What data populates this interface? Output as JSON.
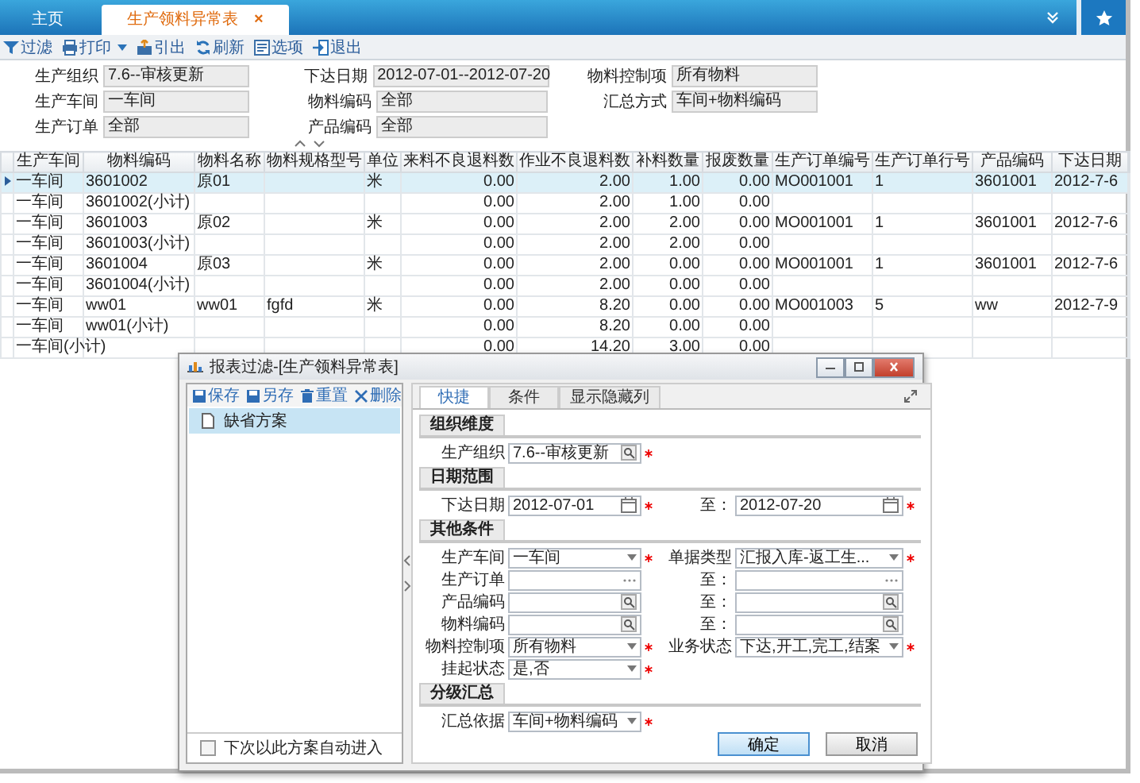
{
  "tabs": [
    {
      "label": "主页",
      "selected": false
    },
    {
      "label": "生产领料异常表",
      "selected": true,
      "close": "×"
    }
  ],
  "toolbar": [
    {
      "label": "过滤",
      "dropdown": false
    },
    {
      "label": "打印",
      "dropdown": true
    },
    {
      "label": "引出",
      "dropdown": false
    },
    {
      "label": "刷新",
      "dropdown": false
    },
    {
      "label": "选项",
      "dropdown": false
    },
    {
      "label": "退出",
      "dropdown": false
    }
  ],
  "summary": [
    {
      "label": "生产组织",
      "value": "7.6--审核更新"
    },
    {
      "label": "下达日期",
      "value": "2012-07-01--2012-07-20"
    },
    {
      "label": "物料控制项",
      "value": "所有物料"
    },
    {
      "label": "生产车间",
      "value": "一车间"
    },
    {
      "label": "物料编码",
      "value": "全部"
    },
    {
      "label": "汇总方式",
      "value": "车间+物料编码"
    },
    {
      "label": "生产订单",
      "value": "全部"
    },
    {
      "label": "产品编码",
      "value": "全部"
    }
  ],
  "grid": {
    "columns": [
      {
        "label": "生产车间",
        "kind": "text"
      },
      {
        "label": "物料编码",
        "kind": "text"
      },
      {
        "label": "物料名称",
        "kind": "text"
      },
      {
        "label": "物料规格型号",
        "kind": "text"
      },
      {
        "label": "单位",
        "kind": "text"
      },
      {
        "label": "来料不良退料数",
        "kind": "number"
      },
      {
        "label": "作业不良退料数",
        "kind": "number"
      },
      {
        "label": "补料数量",
        "kind": "number"
      },
      {
        "label": "报废数量",
        "kind": "number"
      },
      {
        "label": "生产订单编号",
        "kind": "text"
      },
      {
        "label": "生产订单行号",
        "kind": "text"
      },
      {
        "label": "产品编码",
        "kind": "text"
      },
      {
        "label": "下达日期",
        "kind": "text"
      }
    ],
    "rows": [
      {
        "selected": true,
        "cells": [
          "一车间",
          "3601002",
          "原01",
          null,
          "米",
          "0.00",
          "2.00",
          "1.00",
          "0.00",
          "MO001001",
          "1",
          "3601001",
          "2012-7-6"
        ]
      },
      {
        "selected": false,
        "cells": [
          "一车间",
          "3601002(小计)",
          null,
          null,
          null,
          "0.00",
          "2.00",
          "1.00",
          "0.00",
          null,
          null,
          null,
          null
        ]
      },
      {
        "selected": false,
        "cells": [
          "一车间",
          "3601003",
          "原02",
          null,
          "米",
          "0.00",
          "2.00",
          "2.00",
          "0.00",
          "MO001001",
          "1",
          "3601001",
          "2012-7-6"
        ]
      },
      {
        "selected": false,
        "cells": [
          "一车间",
          "3601003(小计)",
          null,
          null,
          null,
          "0.00",
          "2.00",
          "2.00",
          "0.00",
          null,
          null,
          null,
          null
        ]
      },
      {
        "selected": false,
        "cells": [
          "一车间",
          "3601004",
          "原03",
          null,
          "米",
          "0.00",
          "2.00",
          "0.00",
          "0.00",
          "MO001001",
          "1",
          "3601001",
          "2012-7-6"
        ]
      },
      {
        "selected": false,
        "cells": [
          "一车间",
          "3601004(小计)",
          null,
          null,
          null,
          "0.00",
          "2.00",
          "0.00",
          "0.00",
          null,
          null,
          null,
          null
        ]
      },
      {
        "selected": false,
        "cells": [
          "一车间",
          "ww01",
          "ww01",
          "fgfd",
          "米",
          "0.00",
          "8.20",
          "0.00",
          "0.00",
          "MO001003",
          "5",
          "ww",
          "2012-7-9"
        ]
      },
      {
        "selected": false,
        "cells": [
          "一车间",
          "ww01(小计)",
          null,
          null,
          null,
          "0.00",
          "8.20",
          "0.00",
          "0.00",
          null,
          null,
          null,
          null
        ]
      },
      {
        "selected": false,
        "cells": [
          "一车间(小计)",
          null,
          null,
          null,
          null,
          "0.00",
          "14.20",
          "3.00",
          "0.00",
          null,
          null,
          null,
          null
        ]
      }
    ]
  },
  "dialog": {
    "title": "报表过滤-[生产领料异常表]",
    "toolbar": [
      {
        "label": "保存"
      },
      {
        "label": "另存"
      },
      {
        "label": "重置"
      },
      {
        "label": "删除"
      }
    ],
    "schemes": [
      {
        "label": "缺省方案",
        "selected": true
      }
    ],
    "auto_enter": {
      "label": "下次以此方案自动进入",
      "checked": false
    },
    "tabs": [
      {
        "label": "快捷",
        "selected": true
      },
      {
        "label": "条件",
        "selected": false
      },
      {
        "label": "显示隐藏列",
        "selected": false
      }
    ],
    "sections": [
      {
        "title": "组织维度",
        "rows": [
          [
            {
              "label": "生产组织",
              "value": "7.6--审核更新",
              "kind": "lookup",
              "required": true
            }
          ]
        ]
      },
      {
        "title": "日期范围",
        "rows": [
          [
            {
              "label": "下达日期",
              "value": "2012-07-01",
              "kind": "date",
              "required": true
            },
            {
              "label": "至：",
              "value": "2012-07-20",
              "kind": "date",
              "required": true
            }
          ]
        ]
      },
      {
        "title": "其他条件",
        "rows": [
          [
            {
              "label": "生产车间",
              "value": "一车间",
              "kind": "dropdown",
              "required": true
            },
            {
              "label": "单据类型",
              "value": "汇报入库-返工生...",
              "kind": "dropdown",
              "required": true
            }
          ],
          [
            {
              "label": "生产订单",
              "kind": "ellipsis",
              "required": false
            },
            {
              "label": "至：",
              "kind": "ellipsis",
              "required": false
            }
          ],
          [
            {
              "label": "产品编码",
              "kind": "lookup",
              "required": false
            },
            {
              "label": "至：",
              "kind": "lookup",
              "required": false
            }
          ],
          [
            {
              "label": "物料编码",
              "kind": "lookup",
              "required": false
            },
            {
              "label": "至：",
              "kind": "lookup",
              "required": false
            }
          ],
          [
            {
              "label": "物料控制项",
              "value": "所有物料",
              "kind": "dropdown",
              "required": true
            },
            {
              "label": "业务状态",
              "value": "下达,开工,完工,结案",
              "kind": "dropdown",
              "required": true
            }
          ],
          [
            {
              "label": "挂起状态",
              "value": "是,否",
              "kind": "dropdown",
              "required": true
            }
          ]
        ]
      },
      {
        "title": "分级汇总",
        "rows": [
          [
            {
              "label": "汇总依据",
              "value": "车间+物料编码",
              "kind": "dropdown",
              "required": true
            }
          ]
        ]
      }
    ],
    "buttons": [
      {
        "label": "确定",
        "default": true
      },
      {
        "label": "取消",
        "default": false
      }
    ]
  }
}
